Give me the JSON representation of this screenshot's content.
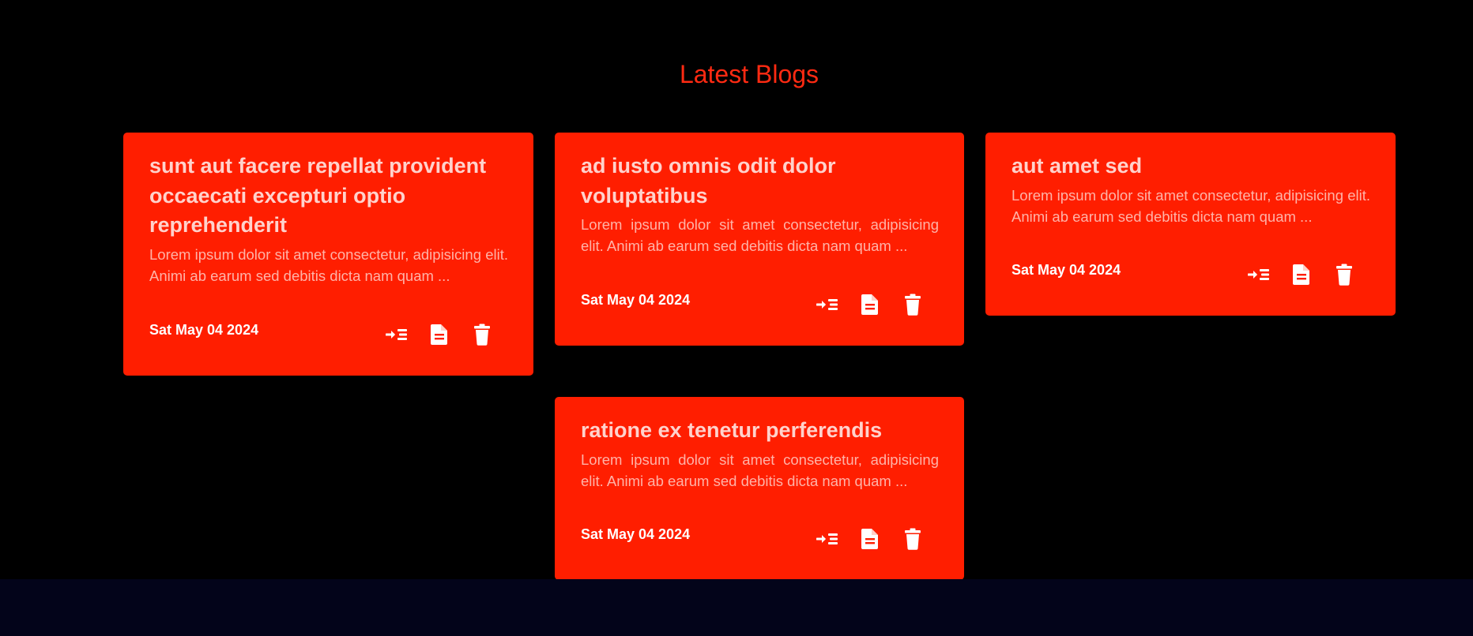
{
  "page": {
    "title": "Latest Blogs"
  },
  "colors": {
    "background": "#000000",
    "accent": "#ff2a12",
    "card": "#ff1e00",
    "footer": "#03041a"
  },
  "icons": {
    "open": "indent-arrow-icon",
    "details": "document-icon",
    "delete": "trash-icon"
  },
  "cards": [
    {
      "title": "sunt aut facere repellat provident occaecati excepturi optio reprehenderit",
      "body": "Lorem ipsum dolor sit amet consectetur, adipisicing elit. Animi ab earum sed debitis dicta nam quam ...",
      "date": "Sat May 04 2024"
    },
    {
      "title": "ad iusto omnis odit dolor voluptatibus",
      "body": "Lorem ipsum dolor sit amet consectetur, adipisicing elit. Animi ab earum sed debitis dicta nam quam ...",
      "date": "Sat May 04 2024"
    },
    {
      "title": "aut amet sed",
      "body": "Lorem ipsum dolor sit amet consectetur, adipisicing elit. Animi ab earum sed debitis dicta nam quam ...",
      "date": "Sat May 04 2024"
    },
    {
      "title": "ratione ex tenetur perferendis",
      "body": "Lorem ipsum dolor sit amet consectetur, adipisicing elit. Animi ab earum sed debitis dicta nam quam ...",
      "date": "Sat May 04 2024"
    }
  ]
}
